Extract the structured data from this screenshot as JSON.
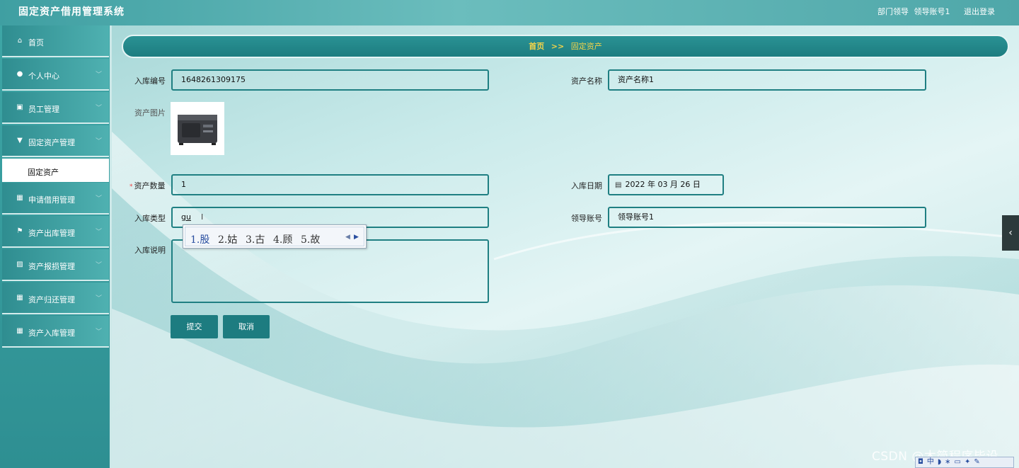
{
  "app": {
    "title": "固定资产借用管理系统",
    "user_role": "部门领导",
    "user_account": "领导账号1",
    "logout_label": "退出登录"
  },
  "sidebar": {
    "items": [
      {
        "label": "首页",
        "icon": "home-icon",
        "glyph": "⌂"
      },
      {
        "label": "个人中心",
        "icon": "user-icon",
        "glyph": "●"
      },
      {
        "label": "员工管理",
        "icon": "clipboard-icon",
        "glyph": "▣"
      },
      {
        "label": "固定资产管理",
        "icon": "pin-icon",
        "glyph": "▼"
      },
      {
        "label": "申请借用管理",
        "icon": "grid-icon",
        "glyph": "▦"
      },
      {
        "label": "资产出库管理",
        "icon": "flag-icon",
        "glyph": "⚑"
      },
      {
        "label": "资产报损管理",
        "icon": "image-icon",
        "glyph": "▨"
      },
      {
        "label": "资产归还管理",
        "icon": "grid-icon",
        "glyph": "▦"
      },
      {
        "label": "资产入库管理",
        "icon": "grid-icon",
        "glyph": "▦"
      }
    ],
    "active_sub": "固定资产"
  },
  "breadcrumb": {
    "home": "首页",
    "separator": ">>",
    "current": "固定资产"
  },
  "form": {
    "labels": {
      "stock_no": "入库编号",
      "asset_name": "资产名称",
      "asset_image": "资产图片",
      "quantity": "资产数量",
      "stock_date": "入库日期",
      "stock_type": "入库类型",
      "leader_account": "领导账号",
      "stock_note": "入库说明"
    },
    "values": {
      "stock_no": "1648261309175",
      "asset_name": "资产名称1",
      "quantity": "1",
      "stock_date": "2022 年 03 月 26 日",
      "stock_type": "gu",
      "leader_account": "领导账号1",
      "stock_note": ""
    },
    "required_mark": "*",
    "submit_label": "提交",
    "cancel_label": "取消"
  },
  "ime": {
    "candidates": [
      "1.股",
      "2.姑",
      "3.古",
      "4.顾",
      "5.故"
    ]
  },
  "watermark": "CSDN @木简程序毕设",
  "colors": {
    "accent": "#1d7c80",
    "breadcrumb_text": "#f2d34a",
    "sidebar": "#3ea6a6"
  }
}
